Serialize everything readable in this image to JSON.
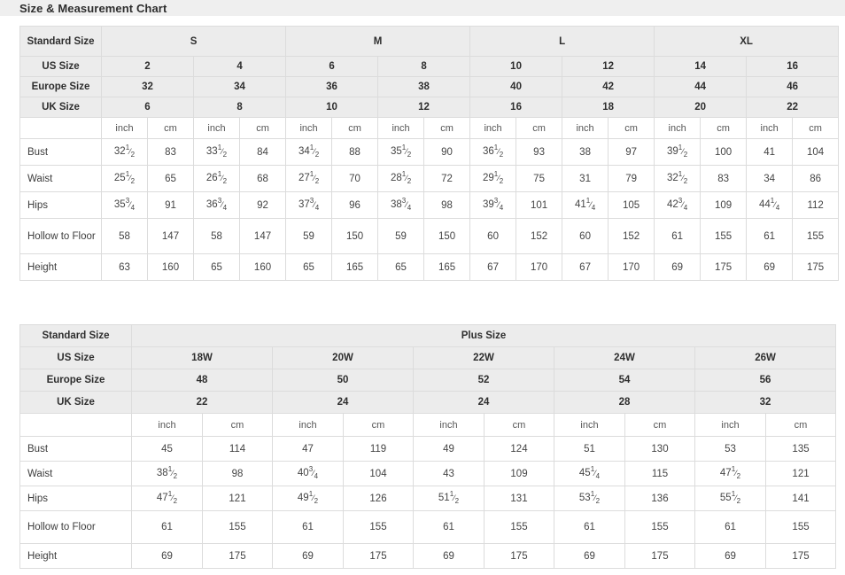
{
  "page": {
    "title": "Size & Measurement Chart",
    "accent_header_bg": "#ececec",
    "border_color": "#dcdcdc",
    "title_band_bg": "#efefef"
  },
  "standard_chart": {
    "label_header": "Standard Size",
    "groups": [
      {
        "label": "S",
        "span": 4
      },
      {
        "label": "M",
        "span": 4
      },
      {
        "label": "L",
        "span": 4
      },
      {
        "label": "XL",
        "span": 4
      }
    ],
    "size_rows": [
      {
        "label": "US Size",
        "values": [
          "2",
          "4",
          "6",
          "8",
          "10",
          "12",
          "14",
          "16"
        ]
      },
      {
        "label": "Europe Size",
        "values": [
          "32",
          "34",
          "36",
          "38",
          "40",
          "42",
          "44",
          "46"
        ]
      },
      {
        "label": "UK Size",
        "values": [
          "6",
          "8",
          "10",
          "12",
          "16",
          "18",
          "20",
          "22"
        ]
      }
    ],
    "unit_row": {
      "blank": "",
      "units": [
        "inch",
        "cm",
        "inch",
        "cm",
        "inch",
        "cm",
        "inch",
        "cm",
        "inch",
        "cm",
        "inch",
        "cm",
        "inch",
        "cm",
        "inch",
        "cm"
      ]
    },
    "measurement_rows": [
      {
        "label": "Bust",
        "cells": [
          {
            "whole": "32",
            "num": "1",
            "den": "2"
          },
          {
            "whole": "83"
          },
          {
            "whole": "33",
            "num": "1",
            "den": "2"
          },
          {
            "whole": "84"
          },
          {
            "whole": "34",
            "num": "1",
            "den": "2"
          },
          {
            "whole": "88"
          },
          {
            "whole": "35",
            "num": "1",
            "den": "2"
          },
          {
            "whole": "90"
          },
          {
            "whole": "36",
            "num": "1",
            "den": "2"
          },
          {
            "whole": "93"
          },
          {
            "whole": "38"
          },
          {
            "whole": "97"
          },
          {
            "whole": "39",
            "num": "1",
            "den": "2"
          },
          {
            "whole": "100"
          },
          {
            "whole": "41"
          },
          {
            "whole": "104"
          }
        ]
      },
      {
        "label": "Waist",
        "cells": [
          {
            "whole": "25",
            "num": "1",
            "den": "2"
          },
          {
            "whole": "65"
          },
          {
            "whole": "26",
            "num": "1",
            "den": "2"
          },
          {
            "whole": "68"
          },
          {
            "whole": "27",
            "num": "1",
            "den": "2"
          },
          {
            "whole": "70"
          },
          {
            "whole": "28",
            "num": "1",
            "den": "2"
          },
          {
            "whole": "72"
          },
          {
            "whole": "29",
            "num": "1",
            "den": "2"
          },
          {
            "whole": "75"
          },
          {
            "whole": "31"
          },
          {
            "whole": "79"
          },
          {
            "whole": "32",
            "num": "1",
            "den": "2"
          },
          {
            "whole": "83"
          },
          {
            "whole": "34"
          },
          {
            "whole": "86"
          }
        ]
      },
      {
        "label": "Hips",
        "cells": [
          {
            "whole": "35",
            "num": "3",
            "den": "4"
          },
          {
            "whole": "91"
          },
          {
            "whole": "36",
            "num": "3",
            "den": "4"
          },
          {
            "whole": "92"
          },
          {
            "whole": "37",
            "num": "3",
            "den": "4"
          },
          {
            "whole": "96"
          },
          {
            "whole": "38",
            "num": "3",
            "den": "4"
          },
          {
            "whole": "98"
          },
          {
            "whole": "39",
            "num": "3",
            "den": "4"
          },
          {
            "whole": "101"
          },
          {
            "whole": "41",
            "num": "1",
            "den": "4"
          },
          {
            "whole": "105"
          },
          {
            "whole": "42",
            "num": "3",
            "den": "4"
          },
          {
            "whole": "109"
          },
          {
            "whole": "44",
            "num": "1",
            "den": "4"
          },
          {
            "whole": "112"
          }
        ]
      },
      {
        "label": "Hollow to Floor",
        "tall": true,
        "cells": [
          {
            "whole": "58"
          },
          {
            "whole": "147"
          },
          {
            "whole": "58"
          },
          {
            "whole": "147"
          },
          {
            "whole": "59"
          },
          {
            "whole": "150"
          },
          {
            "whole": "59"
          },
          {
            "whole": "150"
          },
          {
            "whole": "60"
          },
          {
            "whole": "152"
          },
          {
            "whole": "60"
          },
          {
            "whole": "152"
          },
          {
            "whole": "61"
          },
          {
            "whole": "155"
          },
          {
            "whole": "61"
          },
          {
            "whole": "155"
          }
        ]
      },
      {
        "label": "Height",
        "cells": [
          {
            "whole": "63"
          },
          {
            "whole": "160"
          },
          {
            "whole": "65"
          },
          {
            "whole": "160"
          },
          {
            "whole": "65"
          },
          {
            "whole": "165"
          },
          {
            "whole": "65"
          },
          {
            "whole": "165"
          },
          {
            "whole": "67"
          },
          {
            "whole": "170"
          },
          {
            "whole": "67"
          },
          {
            "whole": "170"
          },
          {
            "whole": "69"
          },
          {
            "whole": "175"
          },
          {
            "whole": "69"
          },
          {
            "whole": "175"
          }
        ]
      }
    ]
  },
  "plus_chart": {
    "label_header": "Standard Size",
    "group_label": "Plus Size",
    "size_rows": [
      {
        "label": "US Size",
        "values": [
          "18W",
          "20W",
          "22W",
          "24W",
          "26W"
        ]
      },
      {
        "label": "Europe Size",
        "values": [
          "48",
          "50",
          "52",
          "54",
          "56"
        ]
      },
      {
        "label": "UK Size",
        "values": [
          "22",
          "24",
          "24",
          "28",
          "32"
        ]
      }
    ],
    "unit_row": {
      "blank": "",
      "units": [
        "inch",
        "cm",
        "inch",
        "cm",
        "inch",
        "cm",
        "inch",
        "cm",
        "inch",
        "cm"
      ]
    },
    "measurement_rows": [
      {
        "label": "Bust",
        "cells": [
          {
            "whole": "45"
          },
          {
            "whole": "114"
          },
          {
            "whole": "47"
          },
          {
            "whole": "119"
          },
          {
            "whole": "49"
          },
          {
            "whole": "124"
          },
          {
            "whole": "51"
          },
          {
            "whole": "130"
          },
          {
            "whole": "53"
          },
          {
            "whole": "135"
          }
        ]
      },
      {
        "label": "Waist",
        "cells": [
          {
            "whole": "38",
            "num": "1",
            "den": "2"
          },
          {
            "whole": "98"
          },
          {
            "whole": "40",
            "num": "3",
            "den": "4"
          },
          {
            "whole": "104"
          },
          {
            "whole": "43"
          },
          {
            "whole": "109"
          },
          {
            "whole": "45",
            "num": "1",
            "den": "4"
          },
          {
            "whole": "115"
          },
          {
            "whole": "47",
            "num": "1",
            "den": "2"
          },
          {
            "whole": "121"
          }
        ]
      },
      {
        "label": "Hips",
        "cells": [
          {
            "whole": "47",
            "num": "1",
            "den": "2"
          },
          {
            "whole": "121"
          },
          {
            "whole": "49",
            "num": "1",
            "den": "2"
          },
          {
            "whole": "126"
          },
          {
            "whole": "51",
            "num": "1",
            "den": "2"
          },
          {
            "whole": "131"
          },
          {
            "whole": "53",
            "num": "1",
            "den": "2"
          },
          {
            "whole": "136"
          },
          {
            "whole": "55",
            "num": "1",
            "den": "2"
          },
          {
            "whole": "141"
          }
        ]
      },
      {
        "label": "Hollow to Floor",
        "tall": true,
        "cells": [
          {
            "whole": "61"
          },
          {
            "whole": "155"
          },
          {
            "whole": "61"
          },
          {
            "whole": "155"
          },
          {
            "whole": "61"
          },
          {
            "whole": "155"
          },
          {
            "whole": "61"
          },
          {
            "whole": "155"
          },
          {
            "whole": "61"
          },
          {
            "whole": "155"
          }
        ]
      },
      {
        "label": "Height",
        "cells": [
          {
            "whole": "69"
          },
          {
            "whole": "175"
          },
          {
            "whole": "69"
          },
          {
            "whole": "175"
          },
          {
            "whole": "69"
          },
          {
            "whole": "175"
          },
          {
            "whole": "69"
          },
          {
            "whole": "175"
          },
          {
            "whole": "69"
          },
          {
            "whole": "175"
          }
        ]
      }
    ]
  }
}
